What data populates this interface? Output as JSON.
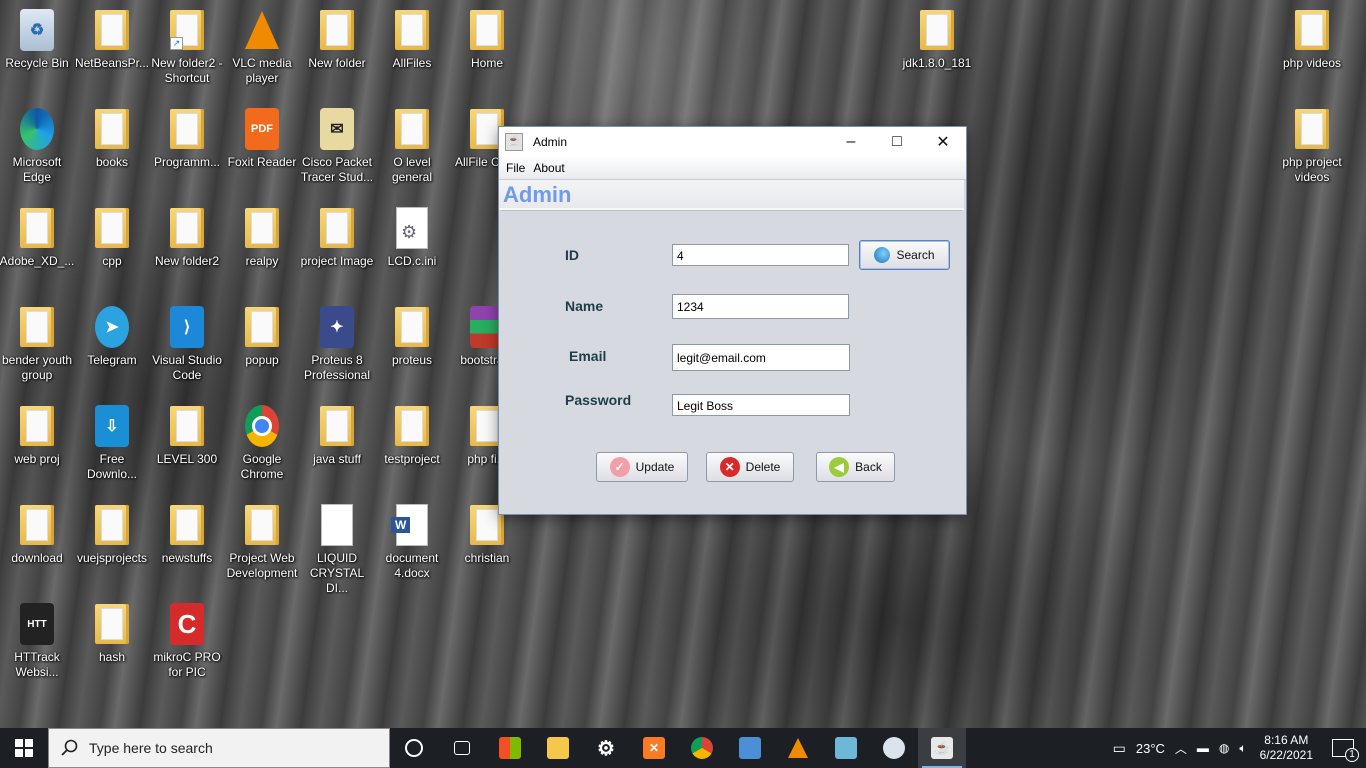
{
  "desktop_icons": [
    {
      "label": "Recycle Bin",
      "icon": "recycle-bin-icon"
    },
    {
      "label": "NetBeansPr...",
      "icon": "folder-icon"
    },
    {
      "label": "New folder2 - Shortcut",
      "icon": "folder-shortcut-icon"
    },
    {
      "label": "VLC media player",
      "icon": "vlc-icon"
    },
    {
      "label": "New folder",
      "icon": "folder-icon"
    },
    {
      "label": "AllFiles",
      "icon": "folder-icon"
    },
    {
      "label": "Home",
      "icon": "folder-icon"
    },
    {
      "label": "jdk1.8.0_181",
      "icon": "folder-icon"
    },
    {
      "label": "php videos",
      "icon": "folder-icon"
    },
    {
      "label": "Microsoft Edge",
      "icon": "edge-icon"
    },
    {
      "label": "books",
      "icon": "folder-icon"
    },
    {
      "label": "Programm...",
      "icon": "folder-icon"
    },
    {
      "label": "Foxit Reader",
      "icon": "foxit-icon"
    },
    {
      "label": "Cisco Packet Tracer Stud...",
      "icon": "packet-tracer-icon"
    },
    {
      "label": "O level general",
      "icon": "folder-icon"
    },
    {
      "label": "AllFile Copy",
      "icon": "folder-icon"
    },
    {
      "label": "php project videos",
      "icon": "folder-icon"
    },
    {
      "label": "Adobe_XD_...",
      "icon": "folder-icon"
    },
    {
      "label": "cpp",
      "icon": "folder-icon"
    },
    {
      "label": "New folder2",
      "icon": "folder-icon"
    },
    {
      "label": "realpy",
      "icon": "folder-icon"
    },
    {
      "label": "project Image",
      "icon": "folder-icon"
    },
    {
      "label": "LCD.c.ini",
      "icon": "settings-file-icon"
    },
    {
      "label": "bender youth group",
      "icon": "folder-icon"
    },
    {
      "label": "Telegram",
      "icon": "telegram-icon"
    },
    {
      "label": "Visual Studio Code",
      "icon": "vscode-icon"
    },
    {
      "label": "popup",
      "icon": "folder-icon"
    },
    {
      "label": "Proteus 8 Professional",
      "icon": "proteus-icon"
    },
    {
      "label": "proteus",
      "icon": "folder-icon"
    },
    {
      "label": "bootstra...",
      "icon": "winrar-icon"
    },
    {
      "label": "web proj",
      "icon": "folder-icon"
    },
    {
      "label": "Free Downlo...",
      "icon": "free-download-icon"
    },
    {
      "label": "LEVEL 300",
      "icon": "folder-icon"
    },
    {
      "label": "Google Chrome",
      "icon": "chrome-icon"
    },
    {
      "label": "java stuff",
      "icon": "folder-icon"
    },
    {
      "label": "testproject",
      "icon": "folder-icon"
    },
    {
      "label": "php fi...",
      "icon": "folder-icon"
    },
    {
      "label": "download",
      "icon": "folder-icon"
    },
    {
      "label": "vuejsprojects",
      "icon": "folder-icon"
    },
    {
      "label": "newstuffs",
      "icon": "folder-icon"
    },
    {
      "label": "Project Web Development",
      "icon": "folder-icon"
    },
    {
      "label": "LIQUID CRYSTAL DI...",
      "icon": "blank-file-icon"
    },
    {
      "label": "document 4.docx",
      "icon": "word-document-icon"
    },
    {
      "label": "christian",
      "icon": "folder-icon"
    },
    {
      "label": "HTTrack Websi...",
      "icon": "httrack-icon"
    },
    {
      "label": "hash",
      "icon": "folder-icon"
    },
    {
      "label": "mikroC PRO for PIC",
      "icon": "mikroc-icon"
    }
  ],
  "window": {
    "title": "Admin",
    "menu": [
      "File",
      "About"
    ],
    "header": "Admin",
    "form": {
      "id_label": "ID",
      "id_value": "4",
      "name_label": "Name",
      "name_value": "1234",
      "email_label": "Email",
      "email_value": "legit@email.com",
      "password_label": "Password",
      "password_value": "Legit Boss"
    },
    "buttons": {
      "search": "Search",
      "update": "Update",
      "delete": "Delete",
      "back": "Back"
    }
  },
  "taskbar": {
    "search_placeholder": "Type here to search",
    "apps": [
      "cortana-icon",
      "task-view-icon",
      "store-icon",
      "file-explorer-icon",
      "settings-icon",
      "xampp-icon",
      "chrome-icon",
      "virtualbox-icon",
      "vlc-icon",
      "notepad-icon",
      "paint-icon",
      "java-icon"
    ],
    "weather": "23°C",
    "time": "8:16 AM",
    "date": "6/22/2021",
    "notification_count": "1"
  },
  "colors": {
    "header_text": "#6f9be8",
    "label_text": "#1d3d4a",
    "taskbar": "#1c1f24"
  }
}
